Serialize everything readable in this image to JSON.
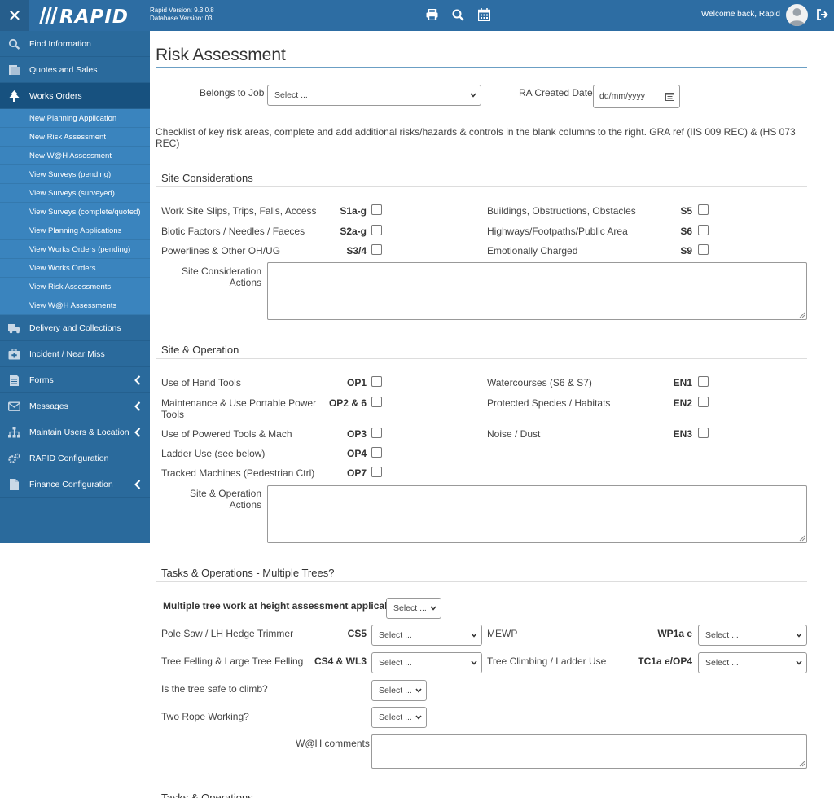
{
  "header": {
    "logo_text": "//IRAPID",
    "rapid_version": "Rapid Version: 9.3.0.8",
    "db_version": "Database Version: 03",
    "welcome": "Welcome back, Rapid",
    "brand_color": "#2d6da3"
  },
  "sidebar": {
    "items_top": [
      {
        "label": "Find Information",
        "icon": "search-icon"
      },
      {
        "label": "Quotes and Sales",
        "icon": "quotes-icon"
      },
      {
        "label": "Works Orders",
        "icon": "tree-icon"
      }
    ],
    "sub_items": [
      "New Planning Application",
      "New Risk Assessment",
      "New W@H Assessment",
      "View Surveys (pending)",
      "View Surveys (surveyed)",
      "View Surveys (complete/quoted)",
      "View Planning Applications",
      "View Works Orders (pending)",
      "View Works Orders",
      "View Risk Assessments",
      "View W@H Assessments"
    ],
    "items_bottom": [
      {
        "label": "Delivery and Collections",
        "icon": "truck-icon"
      },
      {
        "label": "Incident / Near Miss",
        "icon": "medical-kit-icon"
      },
      {
        "label": "Forms",
        "icon": "document-icon"
      },
      {
        "label": "Messages",
        "icon": "envelope-icon"
      },
      {
        "label": "Maintain Users & Location",
        "icon": "sitemap-icon"
      },
      {
        "label": "RAPID Configuration",
        "icon": "gears-icon"
      },
      {
        "label": "Finance Configuration",
        "icon": "file-icon"
      }
    ]
  },
  "page": {
    "title": "Risk Assessment",
    "belongs_to_job_label": "Belongs to Job",
    "belongs_to_job_value": "Select ...",
    "ra_created_label": "RA Created Date",
    "ra_created_placeholder": "dd/mm/yyyy",
    "checklist_note": "Checklist of key risk areas, complete and add additional risks/hazards & controls in the blank columns to the right. GRA ref (IIS 009 REC) & (HS 073 REC)"
  },
  "site_considerations": {
    "title": "Site Considerations",
    "left": [
      {
        "label": "Work Site Slips, Trips, Falls, Access",
        "code": "S1a-g"
      },
      {
        "label": "Biotic Factors / Needles / Faeces",
        "code": "S2a-g"
      },
      {
        "label": "Powerlines & Other OH/UG",
        "code": "S3/4"
      }
    ],
    "right": [
      {
        "label": "Buildings, Obstructions, Obstacles",
        "code": "S5"
      },
      {
        "label": "Highways/Footpaths/Public Area",
        "code": "S6"
      },
      {
        "label": "Emotionally Charged",
        "code": "S9"
      }
    ],
    "actions_label_1": "Site Consideration",
    "actions_label_2": "Actions"
  },
  "site_operation": {
    "title": "Site & Operation",
    "left": [
      {
        "label": "Use of Hand Tools",
        "code": "OP1"
      },
      {
        "label": "Maintenance & Use Portable Power",
        "label2": "Tools",
        "code": "OP2 & 6"
      },
      {
        "label": "Use of Powered Tools & Mach",
        "code": "OP3"
      },
      {
        "label": "Ladder Use (see below)",
        "code": "OP4"
      },
      {
        "label": "Tracked Machines (Pedestrian Ctrl)",
        "code": "OP7"
      }
    ],
    "right": [
      {
        "label": "Watercourses (S6 & S7)",
        "code": "EN1"
      },
      {
        "label": "Protected Species / Habitats",
        "code": "EN2"
      },
      {
        "label": "Noise / Dust",
        "code": "EN3"
      }
    ],
    "actions_label_1": "Site & Operation",
    "actions_label_2": "Actions"
  },
  "tasks": {
    "title": "Tasks & Operations - Multiple Trees?",
    "multi_question": "Multiple tree work at height assessment applicable?",
    "multi_value": "Select ...",
    "pole_saw_label": "Pole Saw / LH Hedge Trimmer",
    "pole_saw_code": "CS5",
    "pole_saw_value": "Select ...",
    "mewp_label": "MEWP",
    "mewp_code": "WP1a e",
    "mewp_value": "Select ...",
    "felling_label": "Tree Felling & Large Tree Felling",
    "felling_code": "CS4 & WL3",
    "felling_value": "Select ...",
    "climbing_label": "Tree Climbing / Ladder Use",
    "climbing_code": "TC1a e/OP4",
    "climbing_value": "Select ...",
    "safe_label": "Is the tree safe to climb?",
    "safe_value": "Select ...",
    "two_rope_label": "Two Rope Working?",
    "two_rope_value": "Select ...",
    "wah_label": "W@H comments"
  },
  "next_section_title": "Tasks & Operations"
}
